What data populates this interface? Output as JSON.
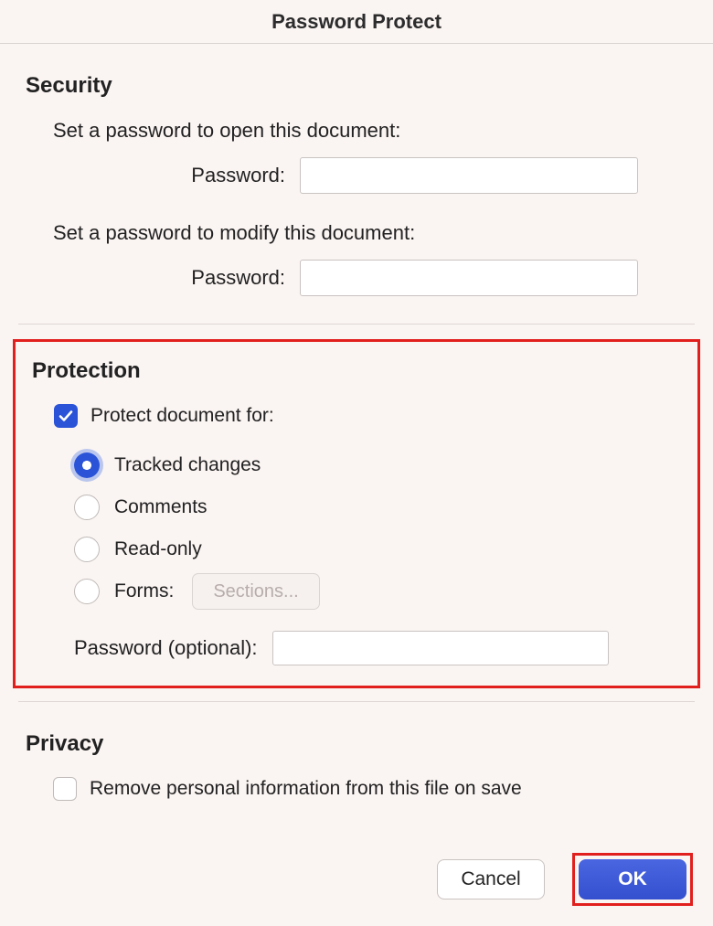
{
  "title": "Password Protect",
  "security": {
    "heading": "Security",
    "open_instruction": "Set a password to open this document:",
    "modify_instruction": "Set a password to modify this document:",
    "password_label": "Password:",
    "open_value": "",
    "modify_value": ""
  },
  "protection": {
    "heading": "Protection",
    "protect_checkbox_label": "Protect document for:",
    "protect_checked": true,
    "radios": {
      "tracked": "Tracked changes",
      "comments": "Comments",
      "readonly": "Read-only",
      "forms": "Forms:"
    },
    "selected_radio": "tracked",
    "sections_btn": "Sections...",
    "password_optional_label": "Password (optional):",
    "password_optional_value": ""
  },
  "privacy": {
    "heading": "Privacy",
    "remove_pii_label": "Remove personal information from this file on save",
    "remove_pii_checked": false
  },
  "footer": {
    "cancel": "Cancel",
    "ok": "OK"
  }
}
